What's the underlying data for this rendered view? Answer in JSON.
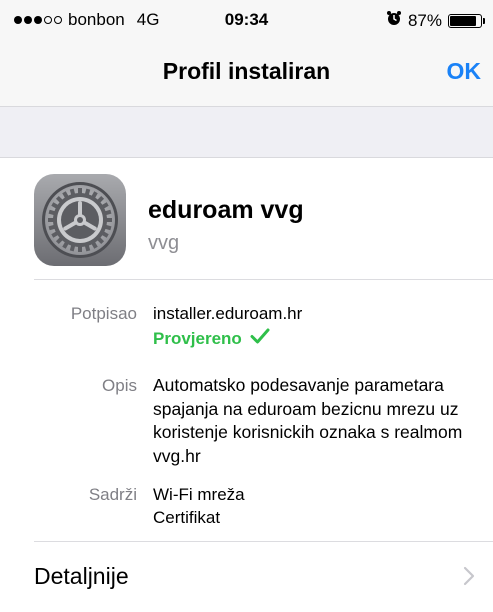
{
  "status_bar": {
    "carrier": "bonbon",
    "network": "4G",
    "time": "09:34",
    "battery_percent": "87%",
    "signal_strength": 3,
    "battery_level": 0.87
  },
  "nav_bar": {
    "title": "Profil instaliran",
    "done_label": "OK"
  },
  "profile": {
    "name": "eduroam vvg",
    "subtitle": "vvg",
    "icon": "settings-gear-icon"
  },
  "details": {
    "signed_by_label": "Potpisao",
    "signed_by_value": "installer.eduroam.hr",
    "verified_label": "Provjereno",
    "description_label": "Opis",
    "description_value": "Automatsko podesavanje parametara spajanja na eduroam bezicnu mrezu uz koristenje korisnickih oznaka s realmom vvg.hr",
    "contains_label": "Sadrži",
    "contains_items": [
      "Wi-Fi mreža",
      "Certifikat"
    ]
  },
  "more_details_label": "Detaljnije",
  "colors": {
    "accent": "#1a82f7",
    "verified": "#2fbf4a",
    "secondary_text": "#7f7f85",
    "bar_background": "#f7f7f7",
    "group_background": "#efeff4"
  }
}
